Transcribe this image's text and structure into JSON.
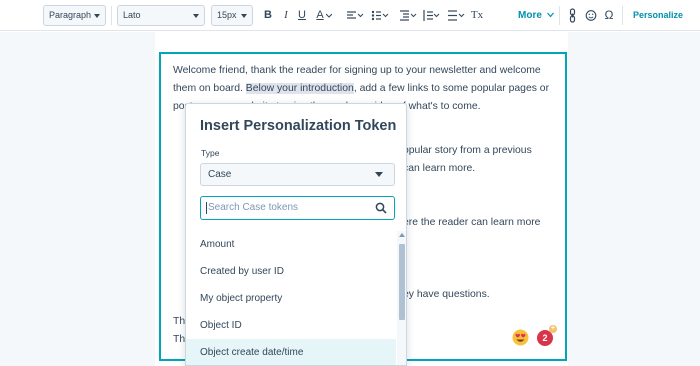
{
  "toolbar": {
    "paragraph_select": "Paragraph",
    "font_select": "Lato",
    "size_select": "15px",
    "bold_label": "B",
    "italic_label": "I",
    "underline_label": "U",
    "text_color_label": "A",
    "more_label": "More",
    "personalize_label": "Personalize",
    "clear_format_label": "Tx"
  },
  "editor": {
    "lines": [
      "Welcome friend, thank the reader for signing up to your newsletter and welcome",
      "them on board.",
      "Below your introduction",
      ", add a few links to some popular pages or",
      "posts on your website to give the reader an idea of what's to come.",
      "opular story from a previous",
      "can learn more.",
      "ere the reader can learn more",
      "ey have questions.",
      "Th",
      "Th"
    ],
    "badge_count": "2"
  },
  "modal": {
    "title": "Insert Personalization Token",
    "type_label": "Type",
    "type_value": "Case",
    "search_placeholder": "Search Case tokens",
    "tokens": [
      "Amount",
      "Created by user ID",
      "My object property",
      "Object ID",
      "Object create date/time"
    ]
  },
  "colors": {
    "accent": "#00a4bd",
    "link": "#0091ae",
    "text": "#33475b",
    "badge": "#d8354a"
  }
}
